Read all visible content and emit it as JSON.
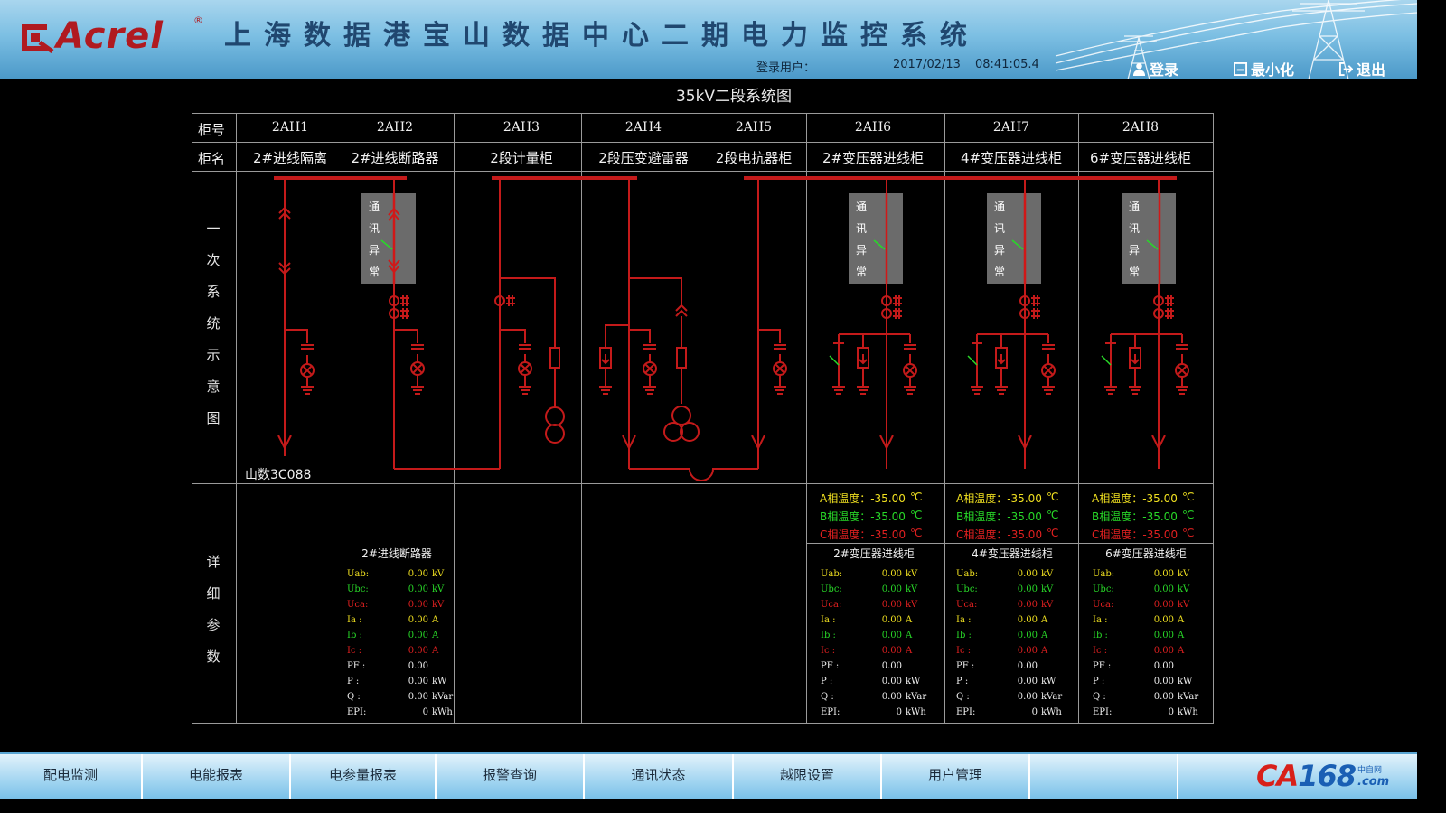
{
  "header": {
    "logo_text": "Acrel",
    "logo_reg": "®",
    "title": "上海数据港宝山数据中心二期电力监控系统",
    "login_user_label": "登录用户：",
    "date": "2017/02/13",
    "time": "08:41:05.4",
    "buttons": {
      "login": "登录",
      "minimize": "最小化",
      "exit": "退出"
    }
  },
  "diagram": {
    "title": "35kV二段系统图",
    "row_labels": {
      "cabinet_no": "柜号",
      "cabinet_name": "柜名",
      "primary": "一次系统示意图",
      "details": "详细参数"
    },
    "comm_status": "通讯异常",
    "meter_label": "山数3C088",
    "cabinets": [
      {
        "no": "2AH1",
        "name": "2#进线隔离"
      },
      {
        "no": "2AH2",
        "name": "2#进线断路器"
      },
      {
        "no": "2AH3",
        "name": "2段计量柜"
      },
      {
        "no": "2AH4",
        "name": "2段压变避雷器"
      },
      {
        "no": "2AH5",
        "name": "2段电抗器柜"
      },
      {
        "no": "2AH6",
        "name": "2#变压器进线柜"
      },
      {
        "no": "2AH7",
        "name": "4#变压器进线柜"
      },
      {
        "no": "2AH8",
        "name": "6#变压器进线柜"
      }
    ],
    "temperatures": [
      {
        "label": "A相温度：",
        "value": "-35.00",
        "unit": "℃"
      },
      {
        "label": "B相温度：",
        "value": "-35.00",
        "unit": "℃"
      },
      {
        "label": "C相温度：",
        "value": "-35.00",
        "unit": "℃"
      }
    ],
    "param_panels": [
      {
        "title": "2#进线断路器"
      },
      {
        "title": "2#变压器进线柜"
      },
      {
        "title": "4#变压器进线柜"
      },
      {
        "title": "6#变压器进线柜"
      }
    ],
    "params": [
      {
        "label": "Uab:",
        "value": "0.00",
        "unit": "kV"
      },
      {
        "label": "Ubc:",
        "value": "0.00",
        "unit": "kV"
      },
      {
        "label": "Uca:",
        "value": "0.00",
        "unit": "kV"
      },
      {
        "label": "Ia :",
        "value": "0.00",
        "unit": "A"
      },
      {
        "label": "Ib :",
        "value": "0.00",
        "unit": "A"
      },
      {
        "label": "Ic :",
        "value": "0.00",
        "unit": "A"
      },
      {
        "label": "PF :",
        "value": "0.00",
        "unit": ""
      },
      {
        "label": "P  :",
        "value": "0.00",
        "unit": "kW"
      },
      {
        "label": "Q  :",
        "value": "0.00",
        "unit": "kVar"
      },
      {
        "label": "EPI:",
        "value": "0",
        "unit": "kWh"
      }
    ]
  },
  "nav": {
    "items": [
      "配电监测",
      "电能报表",
      "电参量报表",
      "报警查询",
      "通讯状态",
      "越限设置",
      "用户管理",
      ""
    ],
    "brand": {
      "ca": "CA",
      "num": "168",
      "cn": "中自网",
      "com": ".com"
    }
  },
  "colors": {
    "line": "#c41a1a",
    "grid": "#9a9a9a",
    "yellow": "#f0e020",
    "green": "#28d828",
    "red": "#e02020"
  },
  "icons": [
    "acrel-logo-icon",
    "power-tower-icon",
    "user-icon",
    "minimize-icon",
    "exit-icon",
    "ca168-logo"
  ]
}
